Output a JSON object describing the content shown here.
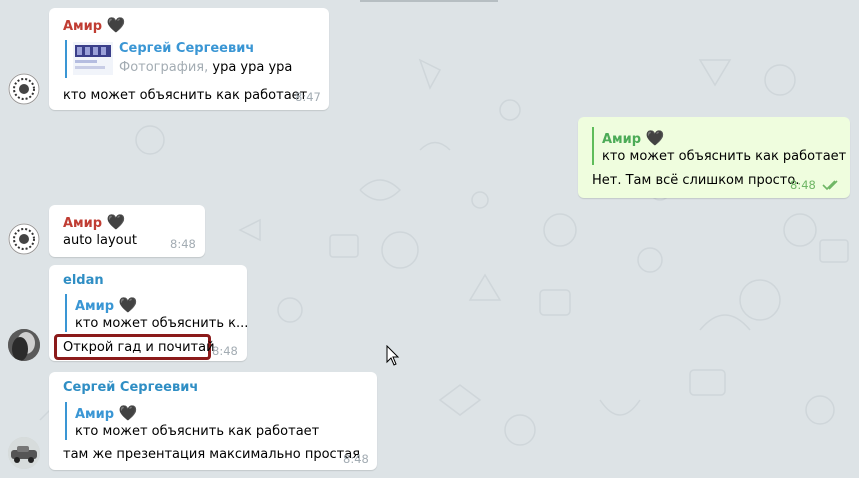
{
  "messages": [
    {
      "sender": "Амир",
      "heart": "🖤",
      "reply": {
        "name": "Сергей Сергеевич",
        "prefix": "Фотография, ",
        "text": "ура ура ура"
      },
      "text": "кто может объяснить как работает",
      "time": "8:47"
    },
    {
      "outgoing": true,
      "reply": {
        "name": "Амир",
        "heart": "🖤",
        "text": "кто может объяснить как работает"
      },
      "text": "Нет. Там всё слишком просто.",
      "time": "8:48",
      "status": "double-check-icon"
    },
    {
      "sender": "Амир",
      "heart": "🖤",
      "text": "auto layout",
      "time": "8:48"
    },
    {
      "sender": "eldan",
      "reply": {
        "name": "Амир",
        "heart": "🖤",
        "text": "кто может объяснить к..."
      },
      "text": "Открой гад и почитай",
      "time": "8:48"
    },
    {
      "sender": "Сергей Сергеевич",
      "reply": {
        "name": "Амир",
        "heart": "🖤",
        "text": "кто может объяснить как работает"
      },
      "text": "там же презентация максимально простая",
      "time": "8:48"
    }
  ],
  "colors": {
    "background": "#dde3e6",
    "bubble_in": "#ffffff",
    "bubble_out": "#effdde",
    "sender_red": "#c03d33",
    "sender_blue": "#2f8ec4",
    "sender_green": "#4cab57",
    "highlight": "#8b1a1a"
  }
}
